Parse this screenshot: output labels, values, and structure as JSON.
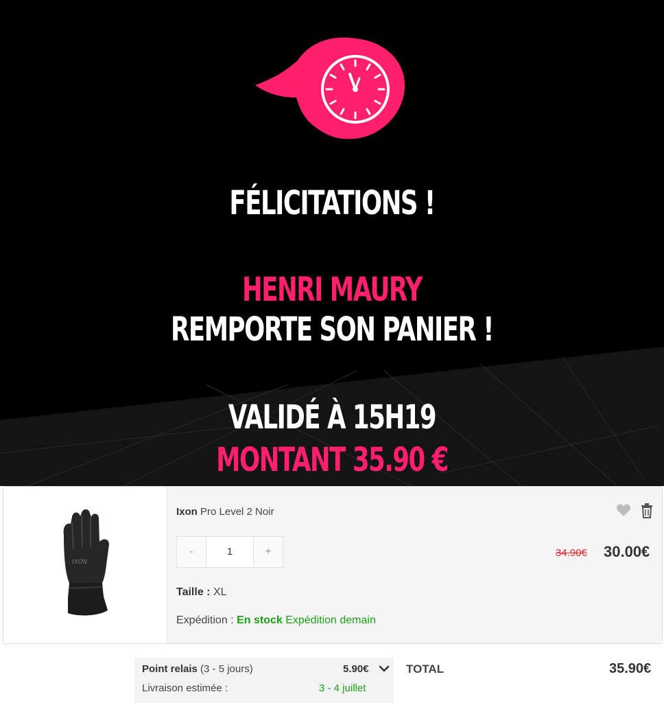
{
  "hero": {
    "congrats": "FÉLICITATIONS !",
    "winner_name": "HENRI MAURY",
    "wins_cart": "REMPORTE SON PANIER !",
    "validated_at": "VALIDÉ À 15H19",
    "amount": "MONTANT 35.90 €",
    "logo_icon": "flaming-clock-icon",
    "accent_color": "#ff1f6e"
  },
  "cart_item": {
    "brand": "Ixon",
    "model": "Pro Level 2 Noir",
    "image_icon": "glove-image",
    "qty_minus": "-",
    "qty_value": "1",
    "qty_plus": "+",
    "old_price": "34.90€",
    "new_price": "30.00€",
    "size_label": "Taille :",
    "size_value": "XL",
    "shipping_label": "Expédition :",
    "stock_status": "En stock",
    "shipping_when": "Expédition demain",
    "wishlist_icon": "heart-icon",
    "delete_icon": "trash-icon",
    "status_color": "#1aa012",
    "strike_color": "#e3262a"
  },
  "delivery": {
    "method": "Point relais",
    "delay": "(3 - 5 jours)",
    "price": "5.90€",
    "estimate_label": "Livraison estimée :",
    "estimate_value": "3 - 4 juillet",
    "dropdown_icon": "chevron-down-icon"
  },
  "total": {
    "label": "TOTAL",
    "value": "35.90€"
  }
}
